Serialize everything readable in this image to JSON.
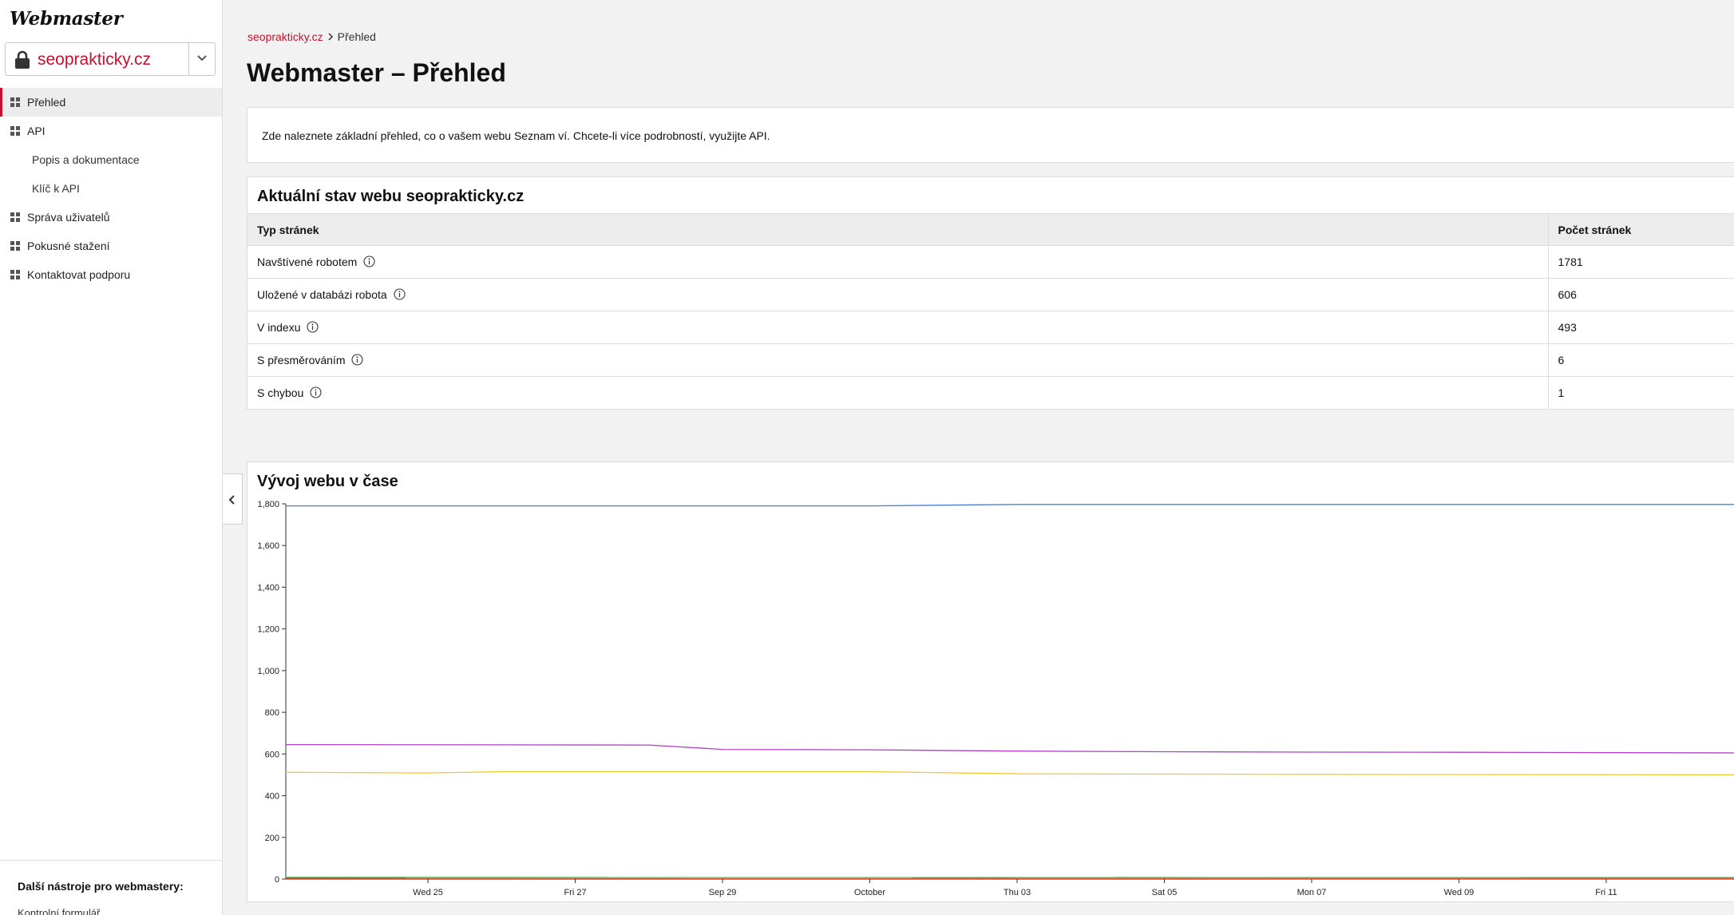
{
  "app": {
    "logo_text": "Webmaster",
    "site": "seoprakticky.cz"
  },
  "sidebar": {
    "items": [
      {
        "label": "Přehled",
        "active": true,
        "icon": "grid-icon"
      },
      {
        "label": "API",
        "icon": "grid-icon"
      },
      {
        "label": "Popis a dokumentace",
        "sub": true
      },
      {
        "label": "Klíč k API",
        "sub": true
      },
      {
        "label": "Správa uživatelů",
        "icon": "grid-icon"
      },
      {
        "label": "Pokusné stažení",
        "icon": "grid-icon"
      },
      {
        "label": "Kontaktovat podporu",
        "icon": "grid-icon"
      }
    ],
    "footer_title": "Další nástroje pro webmastery:",
    "footer_link": "Kontrolní formulář"
  },
  "breadcrumb": {
    "root": "seoprakticky.cz",
    "current": "Přehled"
  },
  "page_title": "Webmaster – Přehled",
  "info_text": "Zde naleznete základní přehled, co o vašem webu Seznam ví. Chcete-li více podrobností, využijte API.",
  "status": {
    "title": "Aktuální stav webu seoprakticky.cz",
    "columns": [
      "Typ stránek",
      "Počet stránek"
    ],
    "rows": [
      {
        "type": "Navštívené robotem",
        "count": "1781"
      },
      {
        "type": "Uložené v databázi robota",
        "count": "606"
      },
      {
        "type": "V indexu",
        "count": "493"
      },
      {
        "type": "S přesměrováním",
        "count": "6"
      },
      {
        "type": "S chybou",
        "count": "1"
      }
    ]
  },
  "chart": {
    "title": "Vývoj webu v čase"
  },
  "colors": {
    "accent": "#c8102e",
    "series_blue": "#4a7fd4",
    "series_purple": "#b040c8",
    "series_yellow": "#f0c830",
    "series_green": "#3ca040",
    "series_red": "#e05030"
  },
  "chart_data": {
    "type": "line",
    "title": "Vývoj webu v čase",
    "xlabel": "",
    "ylabel": "",
    "ylim": [
      0,
      1800
    ],
    "yticks": [
      "0",
      "200",
      "400",
      "600",
      "800",
      "1,000",
      "1,200",
      "1,400",
      "1,600",
      "1,800"
    ],
    "xtick_labels": [
      "Wed 25",
      "Fri 27",
      "Sep 29",
      "October",
      "Thu 03",
      "Sat 05",
      "Mon 07",
      "Wed 09",
      "Fri 11"
    ],
    "x_days": [
      0,
      2,
      4,
      6,
      8,
      10,
      12,
      14,
      16
    ],
    "x_range_days": [
      -1.93,
      17.8
    ],
    "series": [
      {
        "color": "#4a7fd4",
        "x": [
          -1.93,
          6,
          8,
          17.8
        ],
        "y": [
          1790,
          1790,
          1797,
          1797
        ]
      },
      {
        "color": "#b040c8",
        "x": [
          -1.93,
          3.0,
          4.0,
          6.0,
          8.0,
          10.0,
          12.0,
          14.0,
          17.8
        ],
        "y": [
          645,
          643,
          622,
          620,
          614,
          611,
          609,
          608,
          605
        ]
      },
      {
        "color": "#f0c830",
        "x": [
          -1.93,
          0,
          1,
          6,
          8,
          12,
          17.8
        ],
        "y": [
          512,
          509,
          515,
          515,
          505,
          502,
          500
        ]
      },
      {
        "color": "#3ca040",
        "x": [
          -1.93,
          17.8
        ],
        "y": [
          8,
          7
        ]
      },
      {
        "color": "#e05030",
        "x": [
          -1.93,
          17.8
        ],
        "y": [
          3,
          2
        ]
      }
    ]
  }
}
